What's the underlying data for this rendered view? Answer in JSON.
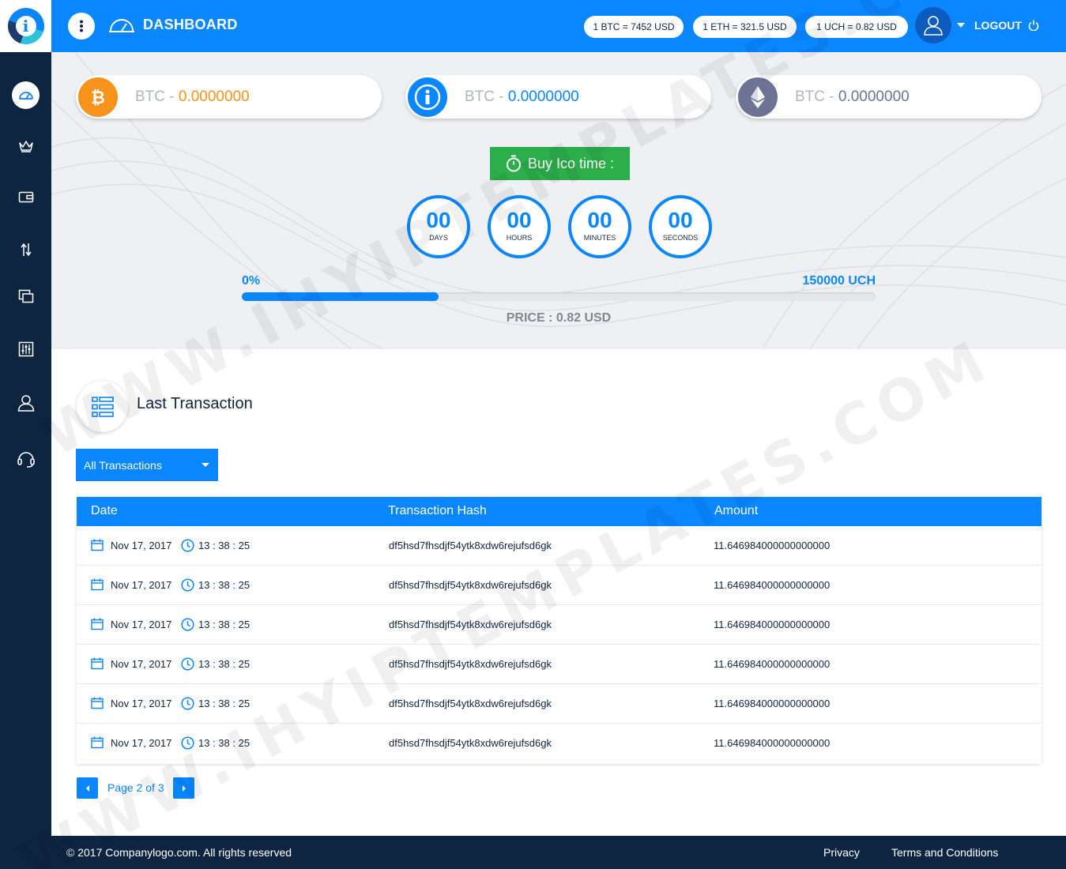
{
  "header": {
    "title": "DASHBOARD",
    "rates": [
      "1 BTC = 7452 USD",
      "1 ETH = 321.5 USD",
      "1 UCH = 0.82 USD"
    ],
    "logout_label": "LOGOUT"
  },
  "sidebar": {
    "items": [
      "dashboard",
      "crown",
      "wallet",
      "transfer",
      "devices",
      "settings-sliders",
      "user",
      "support-headset"
    ]
  },
  "balances": [
    {
      "label": "BTC",
      "separator": " - ",
      "value": "0.0000000",
      "color": "#f7931a",
      "icon": "bitcoin-icon"
    },
    {
      "label": "BTC",
      "separator": " - ",
      "value": "0.0000000",
      "color": "#0a86ff",
      "icon": "ico-coin-icon"
    },
    {
      "label": "BTC",
      "separator": " - ",
      "value": "0.0000000",
      "color": "#6d7394",
      "icon": "ethereum-icon"
    }
  ],
  "ico": {
    "buy_label": "Buy Ico time :",
    "timer": [
      {
        "value": "00",
        "label": "DAYS"
      },
      {
        "value": "00",
        "label": "HOURS"
      },
      {
        "value": "00",
        "label": "MINUTES"
      },
      {
        "value": "00",
        "label": "SECONDS"
      }
    ],
    "progress_start": "0%",
    "progress_end": "150000 UCH",
    "progress_fill_fraction": 0.31,
    "price": "PRICE : 0.82 USD"
  },
  "transactions": {
    "title": "Last Transaction",
    "filter": "All Transactions",
    "columns": [
      "Date",
      "Transaction Hash",
      "Amount"
    ],
    "rows": [
      {
        "date": "Nov 17, 2017",
        "time": "13 : 38 : 25",
        "hash": "df5hsd7fhsdjf54ytk8xdw6rejufsd6gk",
        "amount": "11.646984000000000000"
      },
      {
        "date": "Nov 17, 2017",
        "time": "13 : 38 : 25",
        "hash": "df5hsd7fhsdjf54ytk8xdw6rejufsd6gk",
        "amount": "11.646984000000000000"
      },
      {
        "date": "Nov 17, 2017",
        "time": "13 : 38 : 25",
        "hash": "df5hsd7fhsdjf54ytk8xdw6rejufsd6gk",
        "amount": "11.646984000000000000"
      },
      {
        "date": "Nov 17, 2017",
        "time": "13 : 38 : 25",
        "hash": "df5hsd7fhsdjf54ytk8xdw6rejufsd6gk",
        "amount": "11.646984000000000000"
      },
      {
        "date": "Nov 17, 2017",
        "time": "13 : 38 : 25",
        "hash": "df5hsd7fhsdjf54ytk8xdw6rejufsd6gk",
        "amount": "11.646984000000000000"
      },
      {
        "date": "Nov 17, 2017",
        "time": "13 : 38 : 25",
        "hash": "df5hsd7fhsdjf54ytk8xdw6rejufsd6gk",
        "amount": "11.646984000000000000"
      }
    ],
    "page_label": "Page 2 of 3"
  },
  "footer": {
    "copyright": "© 2017 Companylogo.com. All rights reserved",
    "links": [
      "Privacy",
      "Terms and Conditions"
    ]
  },
  "watermark": "WWW.IHYIPTEMPLATES.COM",
  "colors": {
    "primary": "#0a86ff",
    "sidebar": "#0e2541",
    "buy": "#2cae4a",
    "btc": "#f7931a"
  }
}
